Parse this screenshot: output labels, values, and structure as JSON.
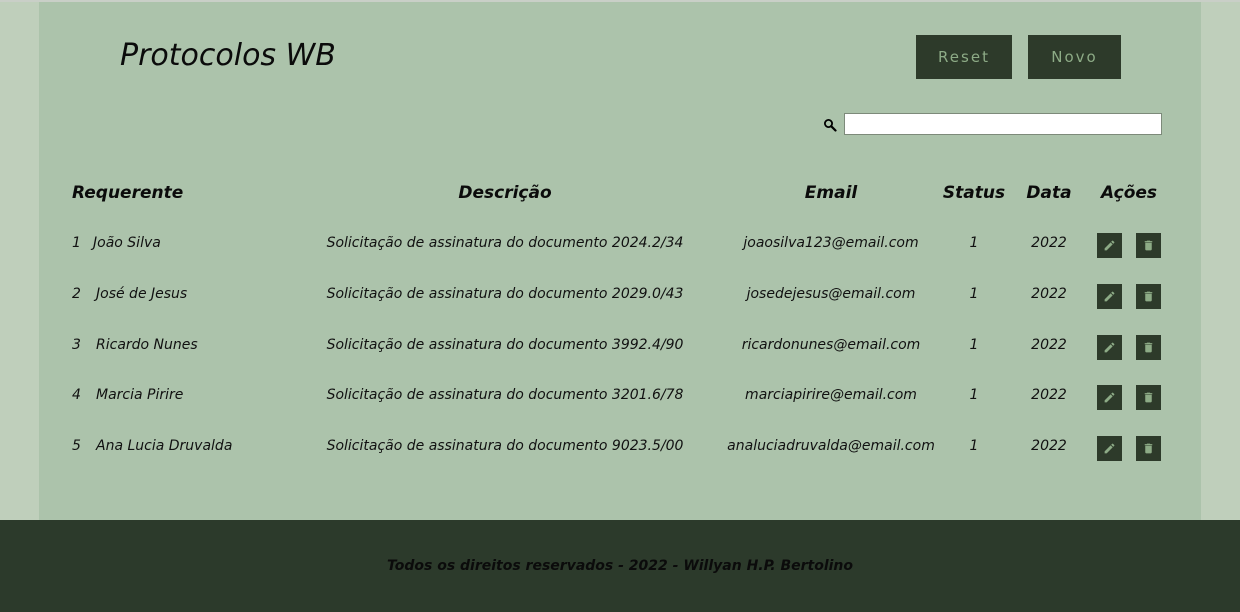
{
  "header": {
    "title": "Protocolos WB",
    "reset_label": "Reset",
    "novo_label": "Novo"
  },
  "search": {
    "value": "",
    "placeholder": ""
  },
  "table": {
    "headers": {
      "requerente": "Requerente",
      "descricao": "Descrição",
      "email": "Email",
      "status": "Status",
      "data": "Data",
      "acoes": "Ações"
    },
    "rows": [
      {
        "id": "1",
        "requerente": "João Silva",
        "descricao": "Solicitação de assinatura do documento 2024.2/34",
        "email": "joaosilva123@email.com",
        "status": "1",
        "data": "2022"
      },
      {
        "id": "2",
        "requerente": "José de Jesus",
        "descricao": "Solicitação de assinatura do documento 2029.0/43",
        "email": "josedejesus@email.com",
        "status": "1",
        "data": "2022"
      },
      {
        "id": "3",
        "requerente": "Ricardo Nunes",
        "descricao": "Solicitação de assinatura do documento 3992.4/90",
        "email": "ricardonunes@email.com",
        "status": "1",
        "data": "2022"
      },
      {
        "id": "4",
        "requerente": "Marcia Pirire",
        "descricao": "Solicitação de assinatura do documento 3201.6/78",
        "email": "marciapirire@email.com",
        "status": "1",
        "data": "2022"
      },
      {
        "id": "5",
        "requerente": "Ana Lucia Druvalda",
        "descricao": "Solicitação de assinatura do documento 9023.5/00",
        "email": "analuciadruvalda@email.com",
        "status": "1",
        "data": "2022"
      }
    ],
    "row_actions": [
      "edit-icon",
      "trash-icon"
    ]
  },
  "footer": {
    "text": "Todos os direitos reservados - 2022 - Willyan H.P. Bertolino"
  },
  "colors": {
    "page_bg": "#bfcfbb",
    "panel_bg": "#acc3ab",
    "dark": "#2c3a2b",
    "button_text": "#8dab86"
  }
}
